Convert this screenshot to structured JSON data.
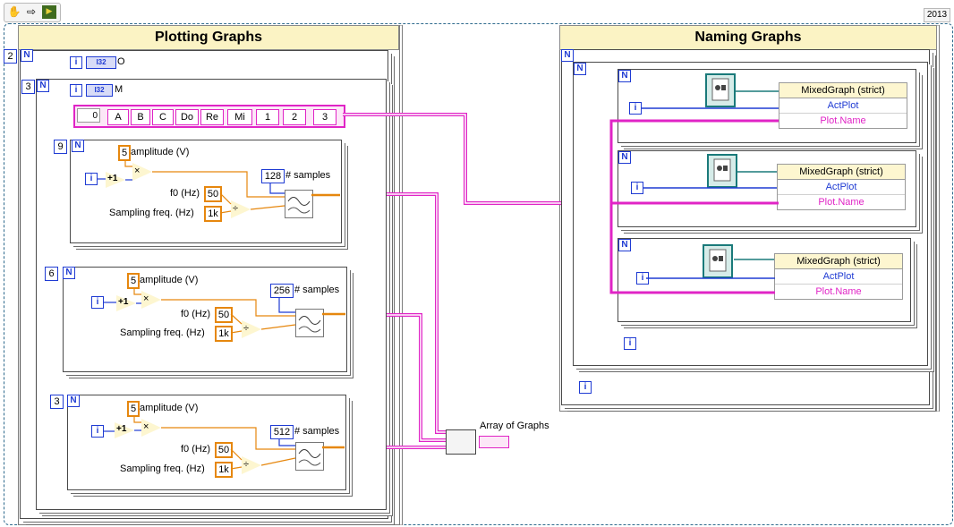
{
  "version": "2013",
  "toolbar": {
    "icons": [
      "hand-icon",
      "arrow-right-icon",
      "run-icon"
    ]
  },
  "plotting": {
    "title": "Plotting Graphs",
    "outer_count": "2",
    "outer_ctrl_type": "I32",
    "outer_ctrl_label": "O",
    "inner_count": "3",
    "inner_ctrl_type": "I32",
    "inner_ctrl_label": "M",
    "array_index": "0",
    "array_items": [
      "A",
      "B",
      "C",
      "Do",
      "Re",
      "Mi",
      "1",
      "2",
      "3"
    ],
    "loops": [
      {
        "count": "9",
        "amplitude": "5",
        "amplitude_label": "amplitude (V)",
        "f0": "50",
        "f0_label": "f0 (Hz)",
        "fs": "1k",
        "fs_label": "Sampling freq. (Hz)",
        "samples": "128",
        "samples_label": "# samples"
      },
      {
        "count": "6",
        "amplitude": "5",
        "amplitude_label": "amplitude (V)",
        "f0": "50",
        "f0_label": "f0 (Hz)",
        "fs": "1k",
        "fs_label": "Sampling freq. (Hz)",
        "samples": "256",
        "samples_label": "# samples"
      },
      {
        "count": "3",
        "amplitude": "5",
        "amplitude_label": "amplitude (V)",
        "f0": "50",
        "f0_label": "f0 (Hz)",
        "fs": "1k",
        "fs_label": "Sampling freq. (Hz)",
        "samples": "512",
        "samples_label": "# samples"
      }
    ],
    "loop_terminal": "N",
    "iter_terminal": "i",
    "output_label": "Array of Graphs"
  },
  "naming": {
    "title": "Naming Graphs",
    "loop_terminal": "N",
    "iter_terminal": "i",
    "nodes": [
      {
        "class": "MixedGraph (strict)",
        "prop1": "ActPlot",
        "prop2": "Plot.Name"
      },
      {
        "class": "MixedGraph (strict)",
        "prop1": "ActPlot",
        "prop2": "Plot.Name"
      },
      {
        "class": "MixedGraph (strict)",
        "prop1": "ActPlot",
        "prop2": "Plot.Name"
      }
    ]
  },
  "colors": {
    "int_blue": "#1f3bd3",
    "dbl_orange": "#e6870e",
    "cluster_pink": "#e024c6",
    "frame_yellow": "#fbf3c4"
  }
}
